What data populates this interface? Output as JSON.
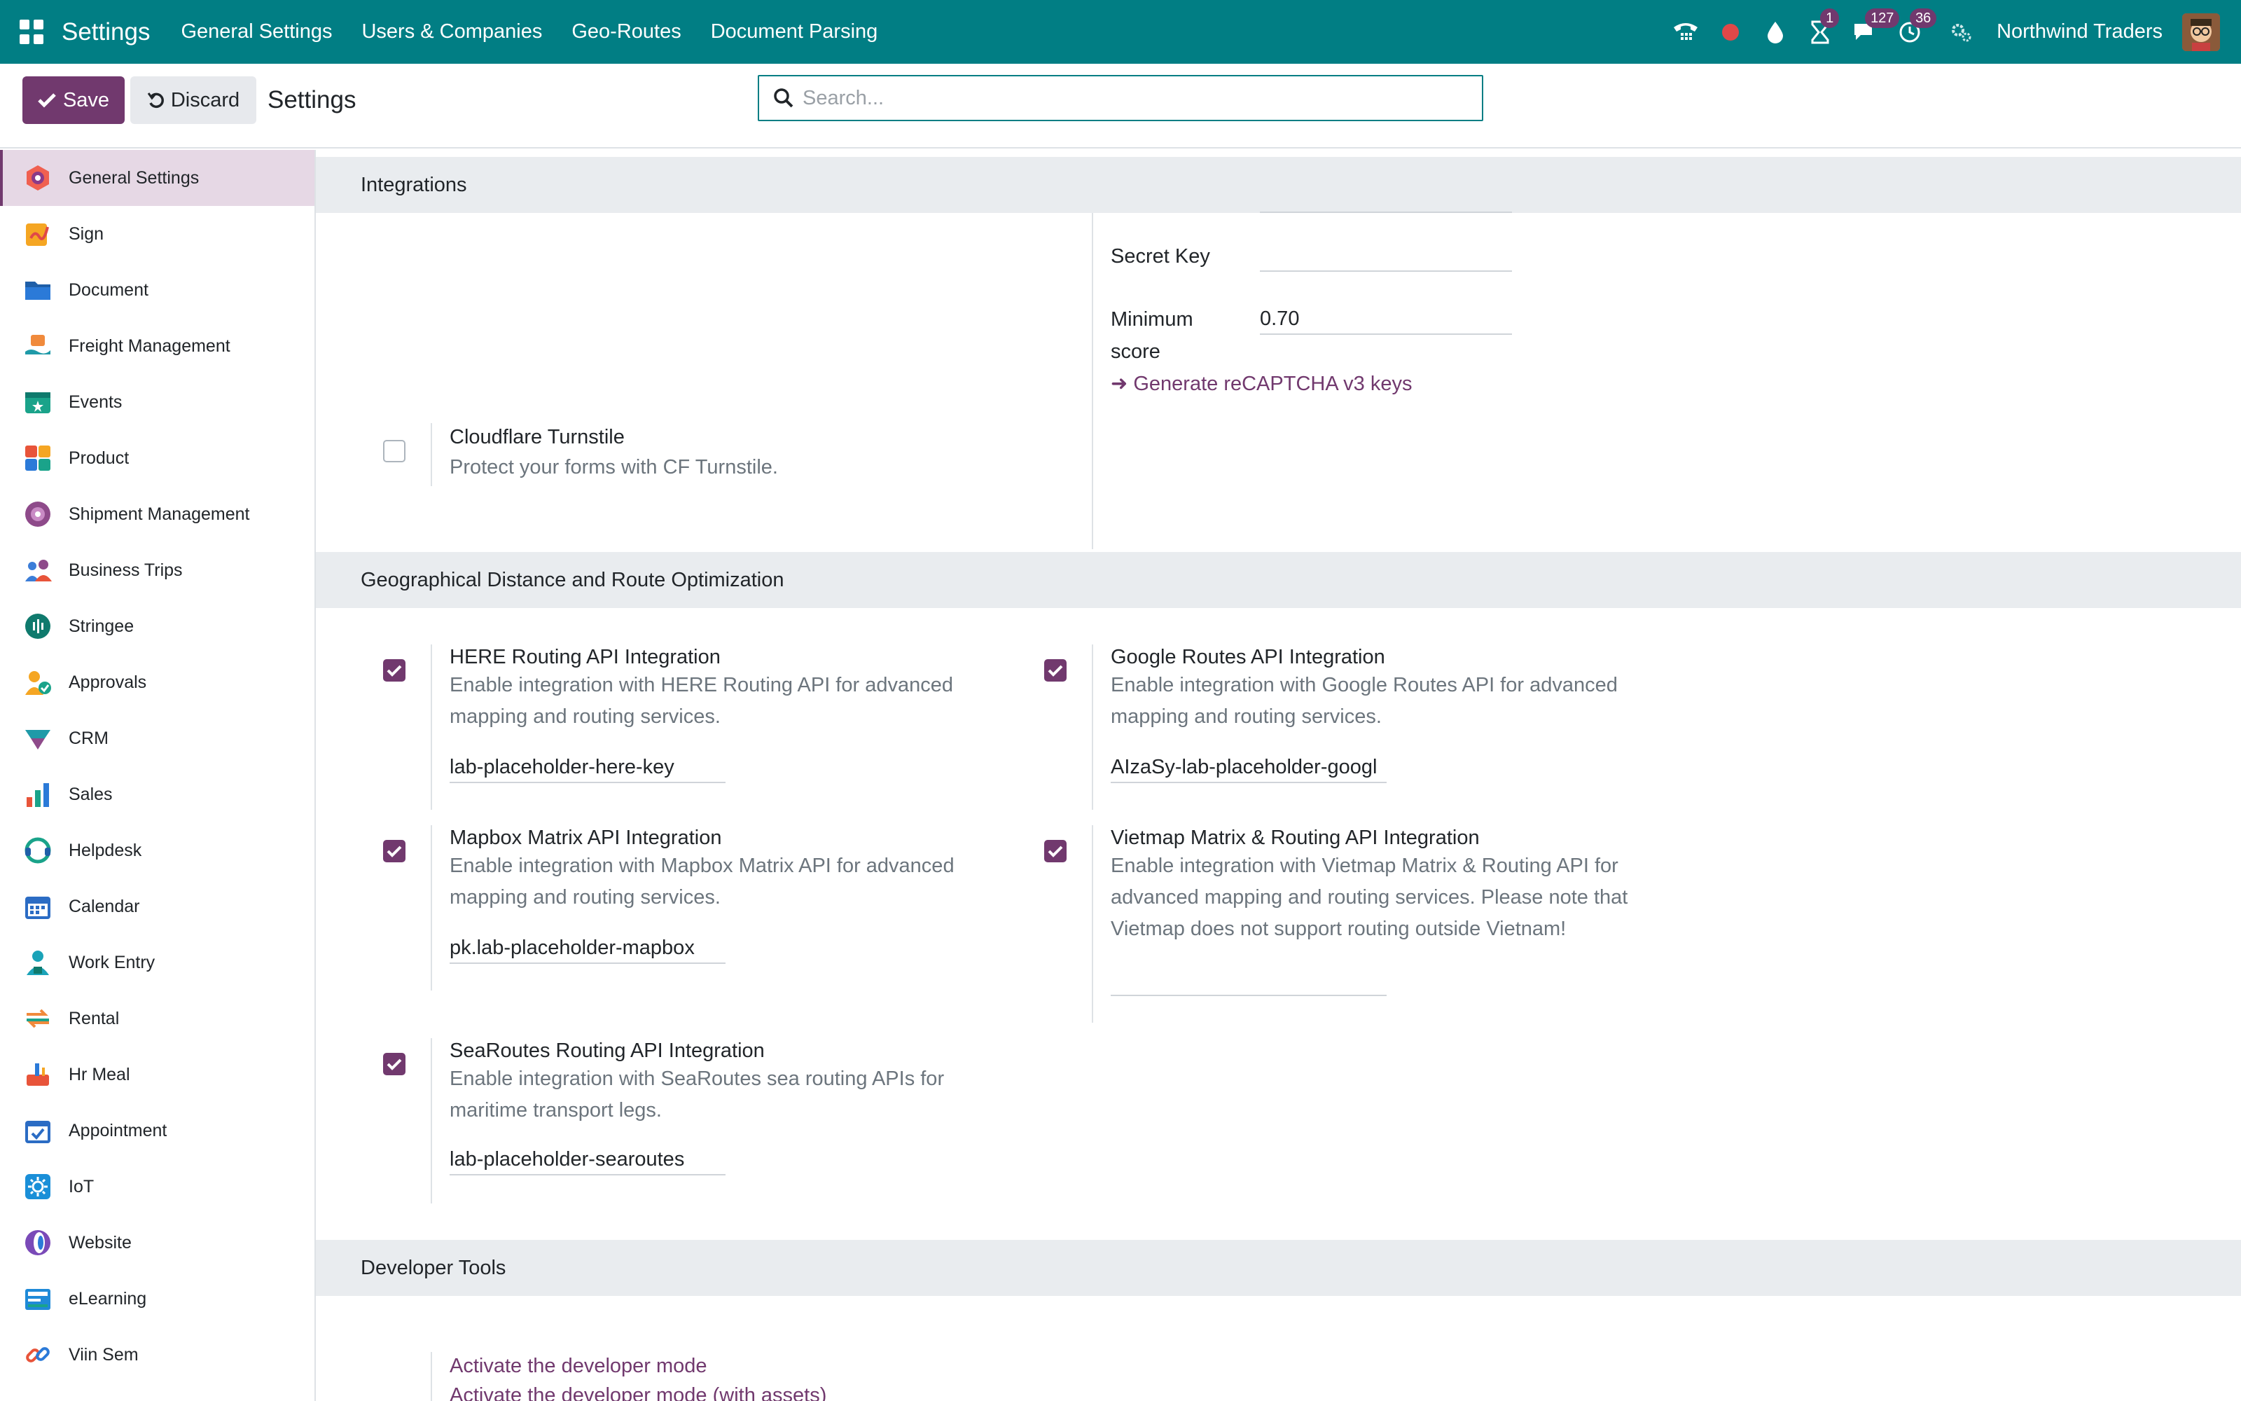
{
  "navbar": {
    "brand": "Settings",
    "menu": [
      "General Settings",
      "Users & Companies",
      "Geo-Routes",
      "Document Parsing"
    ],
    "activities_count": "1",
    "messages_count": "127",
    "timer_count": "36",
    "company": "Northwind Traders"
  },
  "control": {
    "save_label": "Save",
    "discard_label": "Discard",
    "title": "Settings",
    "search_placeholder": "Search..."
  },
  "sidebar": {
    "items": [
      {
        "label": "General Settings",
        "icon": "settings-icon",
        "color": "#f06050"
      },
      {
        "label": "Sign",
        "icon": "sign-icon",
        "color": "#f5a623"
      },
      {
        "label": "Document",
        "icon": "folder-icon",
        "color": "#1f5fa8"
      },
      {
        "label": "Freight Management",
        "icon": "freight-icon",
        "color": "#f08a3c"
      },
      {
        "label": "Events",
        "icon": "events-icon",
        "color": "#1aa38a"
      },
      {
        "label": "Product",
        "icon": "product-icon",
        "color": "#e8543a"
      },
      {
        "label": "Shipment Management",
        "icon": "shipment-icon",
        "color": "#8e4a8a"
      },
      {
        "label": "Business Trips",
        "icon": "trips-icon",
        "color": "#3b7dd8"
      },
      {
        "label": "Stringee",
        "icon": "stringee-icon",
        "color": "#0f7a6d"
      },
      {
        "label": "Approvals",
        "icon": "approvals-icon",
        "color": "#f5a623"
      },
      {
        "label": "CRM",
        "icon": "crm-icon",
        "color": "#1f9aa8"
      },
      {
        "label": "Sales",
        "icon": "sales-icon",
        "color": "#e8543a"
      },
      {
        "label": "Helpdesk",
        "icon": "helpdesk-icon",
        "color": "#1aa38a"
      },
      {
        "label": "Calendar",
        "icon": "calendar-icon",
        "color": "#2b6cc4"
      },
      {
        "label": "Work Entry",
        "icon": "work-entry-icon",
        "color": "#1aa3b8"
      },
      {
        "label": "Rental",
        "icon": "rental-icon",
        "color": "#f08a3c"
      },
      {
        "label": "Hr Meal",
        "icon": "meal-icon",
        "color": "#e8543a"
      },
      {
        "label": "Appointment",
        "icon": "appointment-icon",
        "color": "#2b6cc4"
      },
      {
        "label": "IoT",
        "icon": "iot-icon",
        "color": "#1a8fd8"
      },
      {
        "label": "Website",
        "icon": "website-icon",
        "color": "#7a4ab8"
      },
      {
        "label": "eLearning",
        "icon": "elearning-icon",
        "color": "#1f8ad8"
      },
      {
        "label": "Viin Sem",
        "icon": "link-icon",
        "color": "#e8543a"
      }
    ]
  },
  "integrations": {
    "header": "Integrations",
    "secret_key_label": "Secret Key",
    "secret_key_value": "",
    "min_score_label_1": "Minimum",
    "min_score_label_2": "score",
    "min_score_value": "0.70",
    "recaptcha_link": "Generate reCAPTCHA v3 keys",
    "turnstile_title": "Cloudflare Turnstile",
    "turnstile_desc": "Protect your forms with CF Turnstile."
  },
  "geo": {
    "header": "Geographical Distance and Route Optimization",
    "here_title": "HERE Routing API Integration",
    "here_desc_1": "Enable integration with HERE Routing API for advanced",
    "here_desc_2": "mapping and routing services.",
    "here_key": "lab-placeholder-here-key",
    "google_title": "Google Routes API Integration",
    "google_desc_1": "Enable integration with Google Routes API for advanced",
    "google_desc_2": "mapping and routing services.",
    "google_key": "AIzaSy-lab-placeholder-googl",
    "mapbox_title": "Mapbox Matrix API Integration",
    "mapbox_desc_1": "Enable integration with Mapbox Matrix API for advanced",
    "mapbox_desc_2": "mapping and routing services.",
    "mapbox_key": "pk.lab-placeholder-mapbox",
    "vietmap_title": "Vietmap Matrix & Routing API Integration",
    "vietmap_desc_1": "Enable integration with Vietmap Matrix & Routing API for",
    "vietmap_desc_2": "advanced mapping and routing services. Please note that",
    "vietmap_desc_3": "Vietmap does not support routing outside Vietnam!",
    "vietmap_key": "",
    "searoutes_title": "SeaRoutes Routing API Integration",
    "searoutes_desc_1": "Enable integration with SeaRoutes sea routing APIs for",
    "searoutes_desc_2": "maritime transport legs.",
    "searoutes_key": "lab-placeholder-searoutes"
  },
  "devtools": {
    "header": "Developer Tools",
    "activate": "Activate the developer mode",
    "activate_assets": "Activate the developer mode (with assets)"
  }
}
